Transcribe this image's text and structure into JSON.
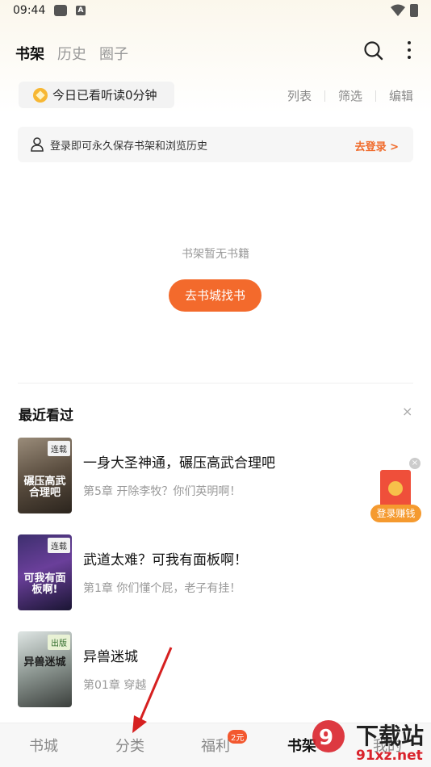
{
  "status_bar": {
    "time": "09:44",
    "icons": [
      "game-icon",
      "a-icon",
      "wifi-icon",
      "battery-icon"
    ]
  },
  "header": {
    "tabs": [
      {
        "label": "书架",
        "active": true
      },
      {
        "label": "历史",
        "active": false
      },
      {
        "label": "圈子",
        "active": false
      }
    ],
    "icons": [
      "search-icon",
      "more-icon"
    ]
  },
  "reading_time": {
    "icon": "coin-icon",
    "text": "今日已看听读0分钟"
  },
  "view_actions": [
    "列表",
    "筛选",
    "编辑"
  ],
  "login_bar": {
    "icon": "user-icon",
    "text": "登录即可永久保存书架和浏览历史",
    "link": "去登录 >"
  },
  "empty_state": {
    "text": "书架暂无书籍",
    "button": "去书城找书"
  },
  "recent": {
    "title": "最近看过",
    "close": "×",
    "books": [
      {
        "title": "一身大圣神通，碾压高武合理吧",
        "chapter": "第5章 开除李牧？你们英明啊！",
        "badge": "连载",
        "cover_title": "碾压高武合理吧"
      },
      {
        "title": "武道太难？可我有面板啊！",
        "chapter": "第1章 你们懂个屁，老子有挂！",
        "badge": "连载",
        "cover_title": "可我有面板啊!"
      },
      {
        "title": "异兽迷城",
        "chapter": "第01章 穿越",
        "badge": "出版",
        "cover_title": "异兽迷城"
      }
    ]
  },
  "red_packet": {
    "label": "登录赚钱",
    "close": "×"
  },
  "bottom_nav": {
    "items": [
      {
        "label": "书城",
        "active": false
      },
      {
        "label": "分类",
        "active": false
      },
      {
        "label": "福利",
        "active": false,
        "badge": "2元"
      },
      {
        "label": "书架",
        "active": true
      },
      {
        "label": "我的",
        "active": false
      }
    ]
  },
  "watermark": {
    "text": "下载站",
    "url": "91xz.net"
  },
  "colors": {
    "accent": "#f36a2c",
    "badge": "#f3582f",
    "coin": "#f7b733"
  }
}
